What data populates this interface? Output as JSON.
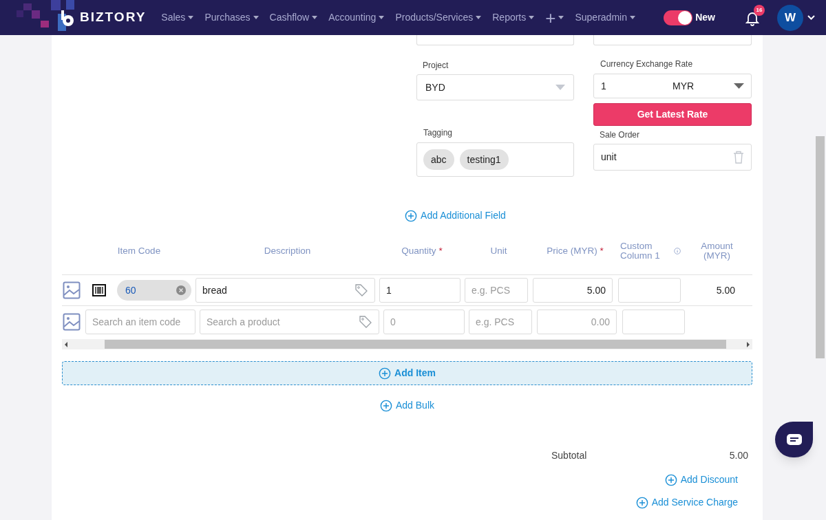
{
  "nav": {
    "brand": "BIZTORY",
    "menu": [
      {
        "label": "Sales",
        "kind": "text"
      },
      {
        "label": "Purchases",
        "kind": "text"
      },
      {
        "label": "Cashflow",
        "kind": "text"
      },
      {
        "label": "Accounting",
        "kind": "text"
      },
      {
        "label": "Products/Services",
        "kind": "text"
      },
      {
        "label": "Reports",
        "kind": "text"
      },
      {
        "label": "+",
        "kind": "plus"
      },
      {
        "label": "Superadmin",
        "kind": "text"
      }
    ],
    "toggle": {
      "label": "New",
      "on": true
    },
    "notifications": {
      "count": "16"
    },
    "avatar": "W"
  },
  "form": {
    "project": {
      "label": "Project",
      "value": "BYD"
    },
    "tagging": {
      "label": "Tagging",
      "tags": [
        "abc",
        "testing1"
      ]
    },
    "exchange": {
      "label": "Currency Exchange Rate",
      "rate": "1",
      "currency": "MYR",
      "button": "Get Latest Rate"
    },
    "sale_order": {
      "label": "Sale Order",
      "value": "unit"
    },
    "add_field": "Add Additional Field"
  },
  "table": {
    "columns": [
      {
        "label": "Item Code",
        "info": false
      },
      {
        "label": "Description",
        "info": false
      },
      {
        "label": "Quantity",
        "required_mark": "*",
        "info": false
      },
      {
        "label": "Unit",
        "info": false
      },
      {
        "label": "Price (MYR)",
        "required_mark": "*",
        "info": false
      },
      {
        "label": "Custom Column 1",
        "info": true
      },
      {
        "label": "Amount (MYR)",
        "info": false
      }
    ],
    "rows": [
      {
        "kind": "filled",
        "item_code": "60",
        "description": "bread",
        "quantity": "1",
        "unit_placeholder": "e.g. PCS",
        "price": "5.00",
        "amount": "5.00"
      },
      {
        "kind": "empty",
        "item_code_placeholder": "Search an item code",
        "description_placeholder": "Search a product",
        "quantity_placeholder": "0",
        "unit_placeholder": "e.g. PCS",
        "price_placeholder": "0.00"
      }
    ]
  },
  "add_item": "Add Item",
  "add_bulk": "Add Bulk",
  "totals": {
    "subtotal_label": "Subtotal",
    "subtotal": "5.00",
    "add_discount": "Add Discount",
    "add_service_charge": "Add Service Charge"
  }
}
